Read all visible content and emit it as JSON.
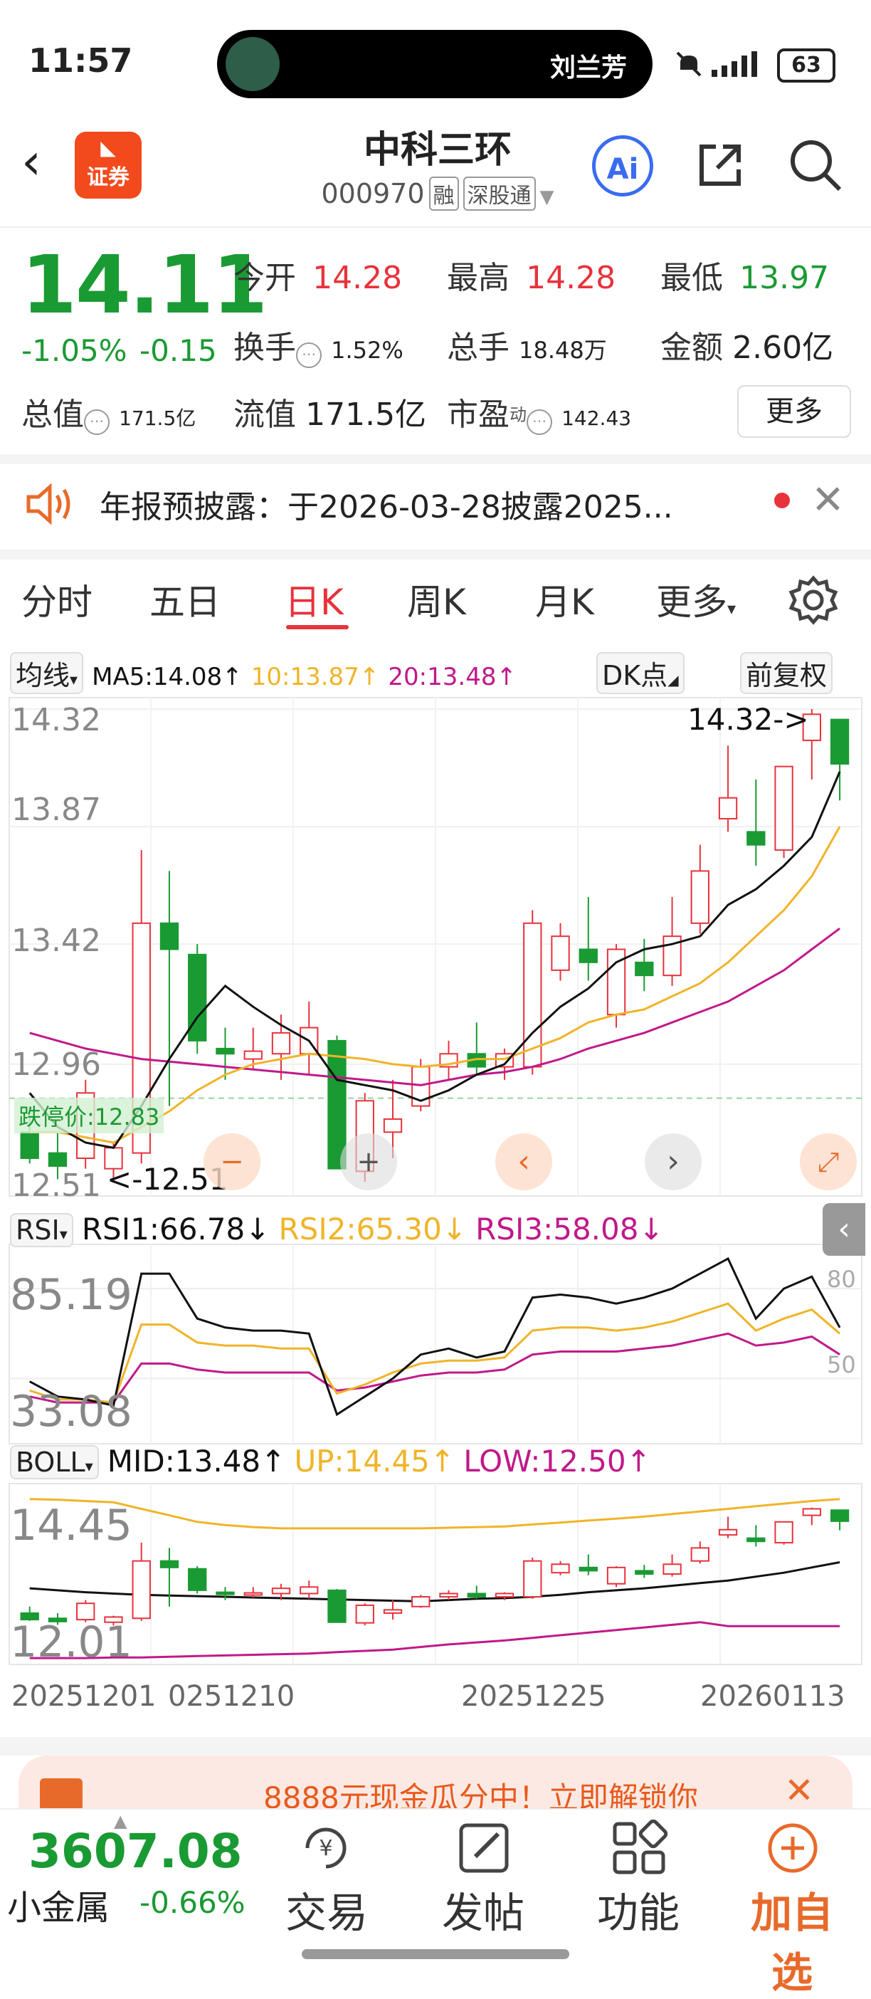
{
  "status_bar": {
    "time": "11:57",
    "contact_name": "刘兰芳",
    "battery": "63"
  },
  "header": {
    "broker_logo_text": "证券",
    "stock_name": "中科三环",
    "stock_code": "000970",
    "tags": [
      "融",
      "深股通"
    ],
    "ai_label": "Ai"
  },
  "quote": {
    "price": "14.11",
    "change_pct": "-1.05%",
    "change": "-0.15",
    "open_label": "今开",
    "open": "14.28",
    "high_label": "最高",
    "high": "14.28",
    "low_label": "最低",
    "low": "13.97",
    "turnover_label": "换手",
    "turnover": "1.52%",
    "volume_label": "总手",
    "volume": "18.48万",
    "amount_label": "金额",
    "amount": "2.60亿",
    "mktcap_label": "总值",
    "mktcap": "171.5亿",
    "float_label": "流值",
    "float_cap": "171.5亿",
    "pe_label": "市盈",
    "pe_sup": "动",
    "pe": "142.43",
    "more_label": "更多"
  },
  "notice": {
    "text": "年报预披露：于2026-03-28披露2025..."
  },
  "tabs": [
    "分时",
    "五日",
    "日K",
    "周K",
    "月K",
    "更多"
  ],
  "active_tab": "日K",
  "ma_row": {
    "selector": "均线",
    "ma5": "MA5:14.08↑",
    "ma10": "10:13.87↑",
    "ma20": "20:13.48↑",
    "dk_label": "DK点",
    "fq_label": "前复权",
    "colors": {
      "ma5": "#111111",
      "ma10": "#f0b429",
      "ma20": "#c0198a"
    }
  },
  "kline_axis": {
    "top": "14.32",
    "l2": "13.87",
    "l3": "13.42",
    "l4": "12.96",
    "bottom": "12.51"
  },
  "kline_notes": {
    "max_note": "14.32->",
    "min_note": "<-12.51",
    "limit_down": "跌停价:12.83"
  },
  "rsi_row": {
    "selector": "RSI",
    "rsi1": "RSI1:66.78↓",
    "rsi2": "RSI2:65.30↓",
    "rsi3": "RSI3:58.08↓",
    "axis_top": "85.19",
    "axis_bottom": "33.08",
    "ref_high": "80",
    "ref_low": "50"
  },
  "boll_row": {
    "selector": "BOLL",
    "mid": "MID:13.48↑",
    "up": "UP:14.45↑",
    "low": "LOW:12.50↑",
    "axis_top": "14.45",
    "axis_bottom": "12.01"
  },
  "x_dates": [
    "20251201",
    "0251210",
    "20251225",
    "20260113"
  ],
  "chart_data": {
    "type": "candlestick",
    "candles": [
      {
        "o": 12.7,
        "h": 12.8,
        "l": 12.58,
        "c": 12.6
      },
      {
        "o": 12.62,
        "h": 12.7,
        "l": 12.52,
        "c": 12.57
      },
      {
        "o": 12.6,
        "h": 12.9,
        "l": 12.56,
        "c": 12.85
      },
      {
        "o": 12.56,
        "h": 12.66,
        "l": 12.51,
        "c": 12.64
      },
      {
        "o": 12.62,
        "h": 13.78,
        "l": 12.58,
        "c": 13.5
      },
      {
        "o": 13.5,
        "h": 13.7,
        "l": 12.8,
        "c": 13.4
      },
      {
        "o": 13.38,
        "h": 13.42,
        "l": 13.0,
        "c": 13.05
      },
      {
        "o": 13.02,
        "h": 13.1,
        "l": 12.9,
        "c": 13.0
      },
      {
        "o": 12.98,
        "h": 13.1,
        "l": 12.94,
        "c": 13.01
      },
      {
        "o": 13.0,
        "h": 13.15,
        "l": 12.9,
        "c": 13.08
      },
      {
        "o": 13.0,
        "h": 13.2,
        "l": 12.92,
        "c": 13.1
      },
      {
        "o": 13.05,
        "h": 13.07,
        "l": 12.56,
        "c": 12.56
      },
      {
        "o": 12.55,
        "h": 12.85,
        "l": 12.51,
        "c": 12.82
      },
      {
        "o": 12.7,
        "h": 12.9,
        "l": 12.6,
        "c": 12.75
      },
      {
        "o": 12.8,
        "h": 12.98,
        "l": 12.78,
        "c": 12.95
      },
      {
        "o": 12.95,
        "h": 13.05,
        "l": 12.9,
        "c": 13.0
      },
      {
        "o": 13.0,
        "h": 13.12,
        "l": 12.92,
        "c": 12.95
      },
      {
        "o": 12.95,
        "h": 13.02,
        "l": 12.9,
        "c": 13.0
      },
      {
        "o": 12.95,
        "h": 13.55,
        "l": 12.92,
        "c": 13.5
      },
      {
        "o": 13.32,
        "h": 13.5,
        "l": 13.28,
        "c": 13.45
      },
      {
        "o": 13.4,
        "h": 13.6,
        "l": 13.28,
        "c": 13.35
      },
      {
        "o": 13.15,
        "h": 13.42,
        "l": 13.1,
        "c": 13.4
      },
      {
        "o": 13.35,
        "h": 13.44,
        "l": 13.24,
        "c": 13.3
      },
      {
        "o": 13.3,
        "h": 13.6,
        "l": 13.26,
        "c": 13.45
      },
      {
        "o": 13.5,
        "h": 13.8,
        "l": 13.46,
        "c": 13.7
      },
      {
        "o": 13.9,
        "h": 14.18,
        "l": 13.85,
        "c": 13.98
      },
      {
        "o": 13.85,
        "h": 14.05,
        "l": 13.72,
        "c": 13.8
      },
      {
        "o": 13.78,
        "h": 14.1,
        "l": 13.75,
        "c": 14.1
      },
      {
        "o": 14.2,
        "h": 14.32,
        "l": 14.05,
        "c": 14.3
      },
      {
        "o": 14.28,
        "h": 14.28,
        "l": 13.97,
        "c": 14.11
      }
    ],
    "ma5": [
      12.85,
      12.72,
      12.66,
      12.64,
      12.8,
      12.98,
      13.14,
      13.26,
      13.18,
      13.11,
      13.05,
      12.9,
      12.88,
      12.86,
      12.82,
      12.86,
      12.92,
      12.96,
      13.08,
      13.18,
      13.25,
      13.35,
      13.4,
      13.42,
      13.45,
      13.57,
      13.63,
      13.72,
      13.83,
      14.08
    ],
    "ma10": [
      12.7,
      12.7,
      12.68,
      12.66,
      12.72,
      12.78,
      12.86,
      12.92,
      12.96,
      12.98,
      13.0,
      12.99,
      12.98,
      12.96,
      12.95,
      12.96,
      12.98,
      12.98,
      13.02,
      13.06,
      13.12,
      13.15,
      13.17,
      13.22,
      13.27,
      13.35,
      13.45,
      13.55,
      13.68,
      13.87
    ],
    "ma20": [
      13.08,
      13.05,
      13.02,
      13.0,
      12.98,
      12.97,
      12.96,
      12.95,
      12.94,
      12.93,
      12.92,
      12.91,
      12.9,
      12.89,
      12.88,
      12.9,
      12.92,
      12.93,
      12.95,
      12.98,
      13.02,
      13.05,
      13.08,
      13.12,
      13.16,
      13.2,
      13.26,
      13.32,
      13.4,
      13.48
    ],
    "rsi1": [
      49,
      44,
      43,
      41,
      85,
      85,
      70,
      67,
      66,
      66,
      65,
      38,
      44,
      50,
      58,
      60,
      57,
      59,
      77,
      78,
      77,
      75,
      77,
      80,
      85,
      90,
      70,
      80,
      84,
      67
    ],
    "rsi2": [
      46,
      43,
      43,
      42,
      68,
      68,
      62,
      61,
      61,
      60,
      60,
      45,
      48,
      52,
      55,
      56,
      56,
      57,
      66,
      67,
      67,
      66,
      67,
      69,
      72,
      75,
      66,
      70,
      73,
      65
    ],
    "rsi3": [
      44,
      42,
      42,
      42,
      55,
      55,
      53,
      52,
      52,
      52,
      52,
      46,
      47,
      49,
      51,
      52,
      52,
      53,
      58,
      59,
      59,
      59,
      60,
      61,
      63,
      65,
      61,
      62,
      64,
      58
    ],
    "boll_up": [
      14.45,
      14.44,
      14.42,
      14.4,
      14.3,
      14.2,
      14.1,
      14.05,
      14.02,
      14.0,
      14.0,
      14.0,
      14.0,
      14.0,
      14.0,
      14.01,
      14.02,
      14.03,
      14.06,
      14.09,
      14.12,
      14.15,
      14.18,
      14.22,
      14.26,
      14.3,
      14.34,
      14.38,
      14.42,
      14.45
    ],
    "boll_mid": [
      13.08,
      13.05,
      13.02,
      13.0,
      12.98,
      12.97,
      12.96,
      12.95,
      12.94,
      12.93,
      12.92,
      12.91,
      12.9,
      12.89,
      12.88,
      12.9,
      12.92,
      12.93,
      12.95,
      12.98,
      13.02,
      13.05,
      13.08,
      13.12,
      13.16,
      13.2,
      13.26,
      13.32,
      13.4,
      13.48
    ],
    "boll_low": [
      12.01,
      12.01,
      12.01,
      12.02,
      12.02,
      12.03,
      12.04,
      12.05,
      12.06,
      12.07,
      12.08,
      12.1,
      12.12,
      12.14,
      12.18,
      12.22,
      12.25,
      12.28,
      12.32,
      12.36,
      12.4,
      12.44,
      12.48,
      12.52,
      12.56,
      12.5,
      12.5,
      12.5,
      12.5,
      12.5
    ]
  },
  "bottom": {
    "banner_text": "8888元现金瓜分中！立即解锁你",
    "index_value": "3607.08",
    "index_name": "小金属",
    "index_pct": "-0.66%",
    "items": [
      "交易",
      "发帖",
      "功能",
      "加自选"
    ]
  }
}
